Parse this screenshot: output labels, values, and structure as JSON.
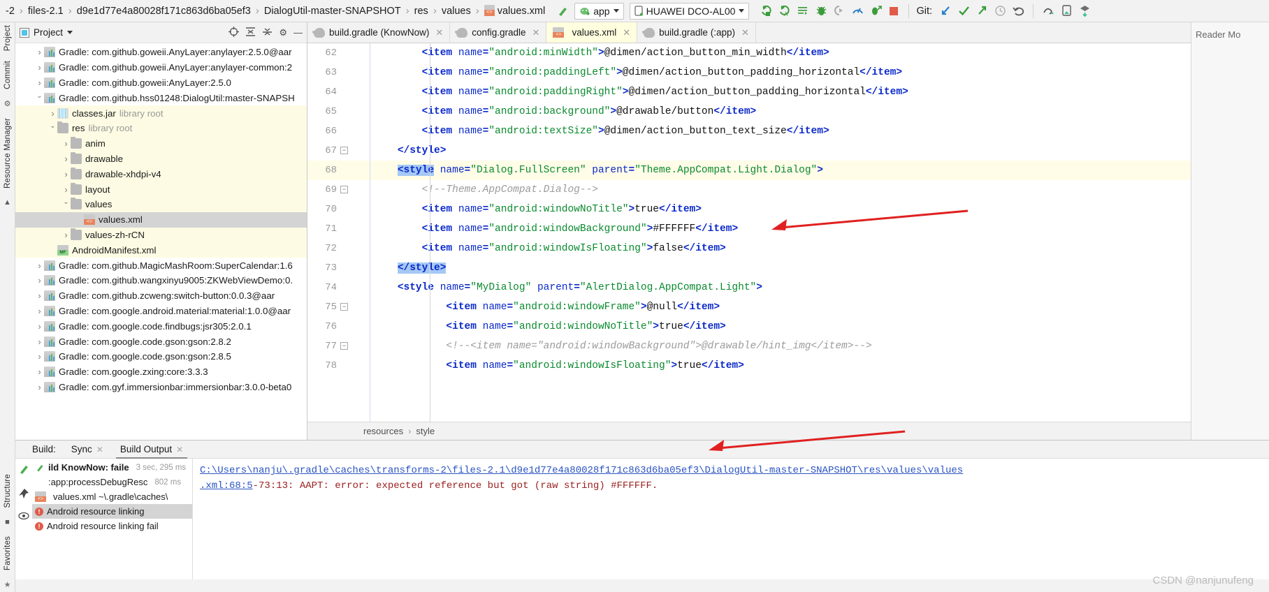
{
  "toolbar": {
    "breadcrumbs": [
      "-2",
      "files-2.1",
      "d9e1d77e4a80028f171c863d6ba05ef3",
      "DialogUtil-master-SNAPSHOT",
      "res",
      "values",
      "values.xml"
    ],
    "build_icon": "hammer-icon",
    "run_config": "app",
    "device": "HUAWEI DCO-AL00",
    "git_label": "Git:",
    "icons": [
      "run-icon",
      "run-with-args-icon",
      "apply-changes-icon",
      "debug-icon",
      "attach-debugger-icon",
      "profiler-icon",
      "debug-attach-icon",
      "stop-icon",
      "git-update-icon",
      "git-commit-icon",
      "git-push-icon",
      "git-history-icon",
      "git-revert-icon",
      "search-everywhere-icon",
      "device-manager-icon",
      "sdk-manager-icon"
    ]
  },
  "left_rail": {
    "top": [
      "Project",
      "Commit"
    ],
    "bottom": [
      "Resource Manager"
    ]
  },
  "project_panel": {
    "title": "Project",
    "actions": [
      "locate-icon",
      "expand-all-icon",
      "collapse-all-icon",
      "settings-icon",
      "hide-icon"
    ],
    "tree": [
      {
        "indent": 1,
        "arrow": "closed",
        "icon": "library-icon",
        "label": "Gradle: com.github.goweii.AnyLayer:anylayer:2.5.0@aar",
        "hl": false
      },
      {
        "indent": 1,
        "arrow": "closed",
        "icon": "library-icon",
        "label": "Gradle: com.github.goweii.AnyLayer:anylayer-common:2",
        "hl": false
      },
      {
        "indent": 1,
        "arrow": "closed",
        "icon": "library-icon",
        "label": "Gradle: com.github.goweii:AnyLayer:2.5.0",
        "hl": false
      },
      {
        "indent": 1,
        "arrow": "open",
        "icon": "library-icon",
        "label": "Gradle: com.github.hss01248:DialogUtil:master-SNAPSH",
        "hl": false
      },
      {
        "indent": 2,
        "arrow": "closed",
        "icon": "jar-icon",
        "label": "classes.jar",
        "note": "library root",
        "hl": true
      },
      {
        "indent": 2,
        "arrow": "open",
        "icon": "folder-icon",
        "label": "res",
        "note": "library root",
        "hl": true
      },
      {
        "indent": 3,
        "arrow": "closed",
        "icon": "folder-icon",
        "label": "anim",
        "hl": true
      },
      {
        "indent": 3,
        "arrow": "closed",
        "icon": "folder-icon",
        "label": "drawable",
        "hl": true
      },
      {
        "indent": 3,
        "arrow": "closed",
        "icon": "folder-icon",
        "label": "drawable-xhdpi-v4",
        "hl": true
      },
      {
        "indent": 3,
        "arrow": "closed",
        "icon": "folder-icon",
        "label": "layout",
        "hl": true
      },
      {
        "indent": 3,
        "arrow": "open",
        "icon": "folder-icon",
        "label": "values",
        "hl": true
      },
      {
        "indent": 4,
        "arrow": "none",
        "icon": "xml-file-icon",
        "label": "values.xml",
        "selected": true
      },
      {
        "indent": 3,
        "arrow": "closed",
        "icon": "folder-icon",
        "label": "values-zh-rCN",
        "hl": true
      },
      {
        "indent": 2,
        "arrow": "none",
        "icon": "manifest-icon",
        "label": "AndroidManifest.xml",
        "hl": true
      },
      {
        "indent": 1,
        "arrow": "closed",
        "icon": "library-icon",
        "label": "Gradle: com.github.MagicMashRoom:SuperCalendar:1.6",
        "hl": false
      },
      {
        "indent": 1,
        "arrow": "closed",
        "icon": "library-icon",
        "label": "Gradle: com.github.wangxinyu9005:ZKWebViewDemo:0.",
        "hl": false
      },
      {
        "indent": 1,
        "arrow": "closed",
        "icon": "library-icon",
        "label": "Gradle: com.github.zcweng:switch-button:0.0.3@aar",
        "hl": false
      },
      {
        "indent": 1,
        "arrow": "closed",
        "icon": "library-icon",
        "label": "Gradle: com.google.android.material:material:1.0.0@aar",
        "hl": false
      },
      {
        "indent": 1,
        "arrow": "closed",
        "icon": "library-icon",
        "label": "Gradle: com.google.code.findbugs:jsr305:2.0.1",
        "hl": false
      },
      {
        "indent": 1,
        "arrow": "closed",
        "icon": "library-icon",
        "label": "Gradle: com.google.code.gson:gson:2.8.2",
        "hl": false
      },
      {
        "indent": 1,
        "arrow": "closed",
        "icon": "library-icon",
        "label": "Gradle: com.google.code.gson:gson:2.8.5",
        "hl": false
      },
      {
        "indent": 1,
        "arrow": "closed",
        "icon": "library-icon",
        "label": "Gradle: com.google.zxing:core:3.3.3",
        "hl": false
      },
      {
        "indent": 1,
        "arrow": "closed",
        "icon": "library-icon",
        "label": "Gradle: com.gyf.immersionbar:immersionbar:3.0.0-beta0",
        "hl": false
      }
    ]
  },
  "editor": {
    "tabs": [
      {
        "label": "build.gradle (KnowNow)",
        "icon": "gradle-icon",
        "active": false
      },
      {
        "label": "config.gradle",
        "icon": "gradle-icon",
        "active": false
      },
      {
        "label": "values.xml",
        "icon": "xml-file-icon",
        "active": true
      },
      {
        "label": "build.gradle (:app)",
        "icon": "gradle-icon",
        "active": false
      }
    ],
    "first_line_number": 62,
    "current_line": 68,
    "lines": [
      {
        "n": 62,
        "indent": 8,
        "parts": [
          {
            "t": "tag",
            "v": "<item"
          },
          {
            "t": "sp",
            "v": " "
          },
          {
            "t": "attr",
            "v": "name"
          },
          {
            "t": "tag",
            "v": "="
          },
          {
            "t": "val",
            "v": "\"android:minWidth\""
          },
          {
            "t": "tag",
            "v": ">"
          },
          {
            "t": "text",
            "v": "@dimen/action_button_min_width"
          },
          {
            "t": "tag",
            "v": "</item>"
          }
        ]
      },
      {
        "n": 63,
        "indent": 8,
        "parts": [
          {
            "t": "tag",
            "v": "<item"
          },
          {
            "t": "sp",
            "v": " "
          },
          {
            "t": "attr",
            "v": "name"
          },
          {
            "t": "tag",
            "v": "="
          },
          {
            "t": "val",
            "v": "\"android:paddingLeft\""
          },
          {
            "t": "tag",
            "v": ">"
          },
          {
            "t": "text",
            "v": "@dimen/action_button_padding_horizontal"
          },
          {
            "t": "tag",
            "v": "</item>"
          }
        ]
      },
      {
        "n": 64,
        "indent": 8,
        "parts": [
          {
            "t": "tag",
            "v": "<item"
          },
          {
            "t": "sp",
            "v": " "
          },
          {
            "t": "attr",
            "v": "name"
          },
          {
            "t": "tag",
            "v": "="
          },
          {
            "t": "val",
            "v": "\"android:paddingRight\""
          },
          {
            "t": "tag",
            "v": ">"
          },
          {
            "t": "text",
            "v": "@dimen/action_button_padding_horizontal"
          },
          {
            "t": "tag",
            "v": "</item>"
          }
        ]
      },
      {
        "n": 65,
        "indent": 8,
        "parts": [
          {
            "t": "tag",
            "v": "<item"
          },
          {
            "t": "sp",
            "v": " "
          },
          {
            "t": "attr",
            "v": "name"
          },
          {
            "t": "tag",
            "v": "="
          },
          {
            "t": "val",
            "v": "\"android:background\""
          },
          {
            "t": "tag",
            "v": ">"
          },
          {
            "t": "text",
            "v": "@drawable/button"
          },
          {
            "t": "tag",
            "v": "</item>"
          }
        ]
      },
      {
        "n": 66,
        "indent": 8,
        "parts": [
          {
            "t": "tag",
            "v": "<item"
          },
          {
            "t": "sp",
            "v": " "
          },
          {
            "t": "attr",
            "v": "name"
          },
          {
            "t": "tag",
            "v": "="
          },
          {
            "t": "val",
            "v": "\"android:textSize\""
          },
          {
            "t": "tag",
            "v": ">"
          },
          {
            "t": "text",
            "v": "@dimen/action_button_text_size"
          },
          {
            "t": "tag",
            "v": "</item>"
          }
        ]
      },
      {
        "n": 67,
        "indent": 4,
        "fold": "minus",
        "parts": [
          {
            "t": "tag",
            "v": "</style>"
          }
        ]
      },
      {
        "n": 68,
        "indent": 4,
        "fold": "minus",
        "current": true,
        "parts": [
          {
            "t": "tagsel",
            "v": "<style"
          },
          {
            "t": "sp",
            "v": " "
          },
          {
            "t": "attr",
            "v": "name"
          },
          {
            "t": "tag",
            "v": "="
          },
          {
            "t": "val",
            "v": "\"Dialog.FullScreen\""
          },
          {
            "t": "sp",
            "v": " "
          },
          {
            "t": "attr",
            "v": "parent"
          },
          {
            "t": "tag",
            "v": "="
          },
          {
            "t": "val",
            "v": "\"Theme.AppCompat.Light.Dialog\""
          },
          {
            "t": "tag",
            "v": ">"
          }
        ]
      },
      {
        "n": 69,
        "indent": 8,
        "parts": [
          {
            "t": "comment",
            "v": "<!--Theme.AppCompat.Dialog-->"
          }
        ]
      },
      {
        "n": 70,
        "indent": 8,
        "parts": [
          {
            "t": "tag",
            "v": "<item"
          },
          {
            "t": "sp",
            "v": " "
          },
          {
            "t": "attr",
            "v": "name"
          },
          {
            "t": "tag",
            "v": "="
          },
          {
            "t": "val",
            "v": "\"android:windowNoTitle\""
          },
          {
            "t": "tag",
            "v": ">"
          },
          {
            "t": "text",
            "v": "true"
          },
          {
            "t": "tag",
            "v": "</item>"
          }
        ]
      },
      {
        "n": 71,
        "indent": 8,
        "parts": [
          {
            "t": "tag",
            "v": "<item"
          },
          {
            "t": "sp",
            "v": " "
          },
          {
            "t": "attr",
            "v": "name"
          },
          {
            "t": "tag",
            "v": "="
          },
          {
            "t": "val",
            "v": "\"android:windowBackground\""
          },
          {
            "t": "tag",
            "v": ">"
          },
          {
            "t": "text",
            "v": "#FFFFFF"
          },
          {
            "t": "tag",
            "v": "</item>"
          }
        ]
      },
      {
        "n": 72,
        "indent": 8,
        "parts": [
          {
            "t": "tag",
            "v": "<item"
          },
          {
            "t": "sp",
            "v": " "
          },
          {
            "t": "attr",
            "v": "name"
          },
          {
            "t": "tag",
            "v": "="
          },
          {
            "t": "val",
            "v": "\"android:windowIsFloating\""
          },
          {
            "t": "tag",
            "v": ">"
          },
          {
            "t": "text",
            "v": "false"
          },
          {
            "t": "tag",
            "v": "</item>"
          }
        ]
      },
      {
        "n": 73,
        "indent": 4,
        "fold": "minus",
        "parts": [
          {
            "t": "tagsel",
            "v": "</style>"
          }
        ]
      },
      {
        "n": 74,
        "indent": 4,
        "fold": "minus",
        "parts": [
          {
            "t": "tag",
            "v": "<style"
          },
          {
            "t": "sp",
            "v": " "
          },
          {
            "t": "attr",
            "v": "name"
          },
          {
            "t": "tag",
            "v": "="
          },
          {
            "t": "val",
            "v": "\"MyDialog\""
          },
          {
            "t": "sp",
            "v": " "
          },
          {
            "t": "attr",
            "v": "parent"
          },
          {
            "t": "tag",
            "v": "="
          },
          {
            "t": "val",
            "v": "\"AlertDialog.AppCompat.Light\""
          },
          {
            "t": "tag",
            "v": ">"
          }
        ]
      },
      {
        "n": 75,
        "indent": 12,
        "parts": [
          {
            "t": "tag",
            "v": "<item"
          },
          {
            "t": "sp",
            "v": " "
          },
          {
            "t": "attr",
            "v": "name"
          },
          {
            "t": "tag",
            "v": "="
          },
          {
            "t": "val",
            "v": "\"android:windowFrame\""
          },
          {
            "t": "tag",
            "v": ">"
          },
          {
            "t": "text",
            "v": "@null"
          },
          {
            "t": "tag",
            "v": "</item>"
          }
        ]
      },
      {
        "n": 76,
        "indent": 12,
        "parts": [
          {
            "t": "tag",
            "v": "<item"
          },
          {
            "t": "sp",
            "v": " "
          },
          {
            "t": "attr",
            "v": "name"
          },
          {
            "t": "tag",
            "v": "="
          },
          {
            "t": "val",
            "v": "\"android:windowNoTitle\""
          },
          {
            "t": "tag",
            "v": ">"
          },
          {
            "t": "text",
            "v": "true"
          },
          {
            "t": "tag",
            "v": "</item>"
          }
        ]
      },
      {
        "n": 77,
        "indent": 12,
        "parts": [
          {
            "t": "comment",
            "v": "<!--<item name=\"android:windowBackground\">@drawable/hint_img</item>-->"
          }
        ]
      },
      {
        "n": 78,
        "indent": 12,
        "parts": [
          {
            "t": "tag",
            "v": "<item"
          },
          {
            "t": "sp",
            "v": " "
          },
          {
            "t": "attr",
            "v": "name"
          },
          {
            "t": "tag",
            "v": "="
          },
          {
            "t": "val",
            "v": "\"android:windowIsFloating\""
          },
          {
            "t": "tag",
            "v": ">"
          },
          {
            "t": "text",
            "v": "true"
          },
          {
            "t": "tag",
            "v": "</item>"
          }
        ]
      }
    ],
    "breadcrumb": [
      "resources",
      "style"
    ],
    "reader_mode_label": "Reader Mo"
  },
  "build_panel": {
    "label": "Build:",
    "tabs": [
      {
        "label": "Sync",
        "active": false
      },
      {
        "label": "Build Output",
        "active": true
      }
    ],
    "rail_icons": [
      "rerun-icon",
      "pin-icon",
      "eye-icon",
      "favorites-star-icon"
    ],
    "tree": [
      {
        "icon": "hammer-icon",
        "label": "ild KnowNow: faile",
        "time": "3 sec, 295 ms",
        "bold": true
      },
      {
        "icon": "none",
        "label": ":app:processDebugResc",
        "time": "802 ms"
      },
      {
        "icon": "xml-file-icon",
        "label": "values.xml ~\\.gradle\\caches\\"
      },
      {
        "icon": "error-icon",
        "label": "Android resource linking",
        "selected": true
      },
      {
        "icon": "error-icon",
        "label": "Android resource linking fail"
      }
    ],
    "detail": {
      "link": "C:\\Users\\nanju\\.gradle\\caches\\transforms-2\\files-2.1\\d9e1d77e4a80028f171c863d6ba05ef3\\DialogUtil-master-SNAPSHOT\\res\\values\\values",
      "link2": ".xml:68:5",
      "error": "-73:13: AAPT: error: expected reference but got (raw string) #FFFFFF."
    }
  },
  "left_rail_bottom": [
    "Structure",
    "Favorites"
  ],
  "watermark": "CSDN @nanjunufeng",
  "colors": {
    "accent_yellow": "#fdfbe3",
    "selection": "#a5c8f5",
    "error_red": "#9c2020",
    "link_blue": "#2b54c4",
    "anno_red": "#e02020"
  }
}
